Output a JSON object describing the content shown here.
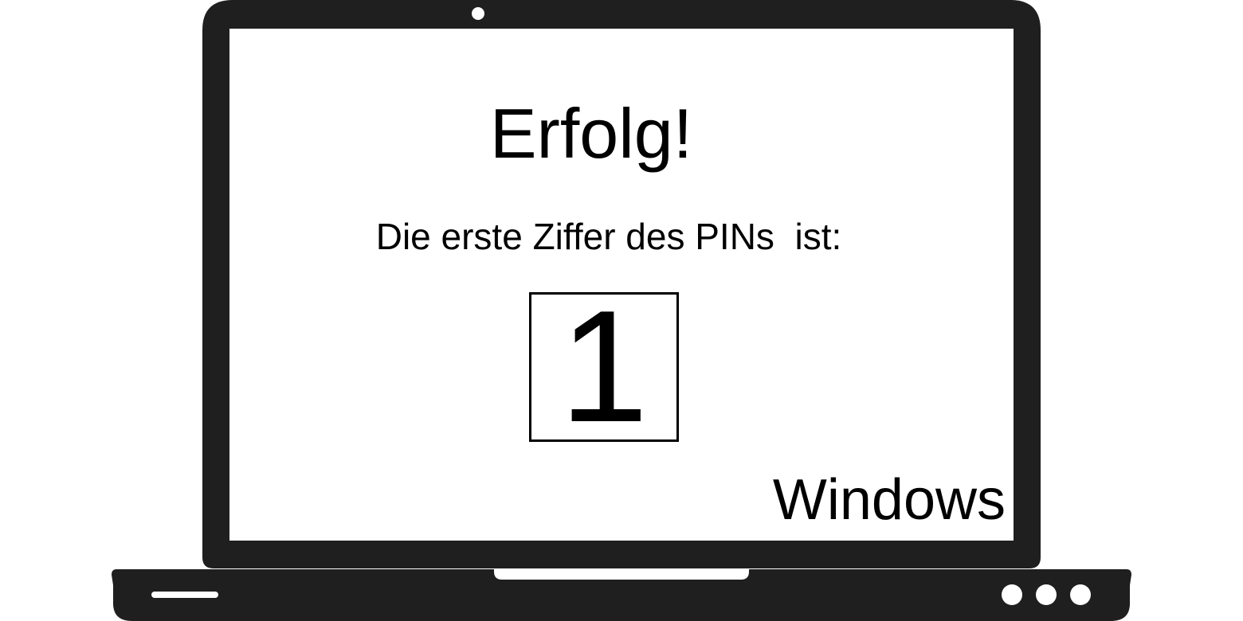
{
  "screen": {
    "title": "Erfolg!",
    "message": "Die erste Ziffer des PINs  ist:",
    "digit": "1",
    "os_label": "Windows"
  },
  "device": {
    "body_color": "#1f1f1f",
    "screen_color": "#ffffff",
    "indicator_lights": 3
  }
}
